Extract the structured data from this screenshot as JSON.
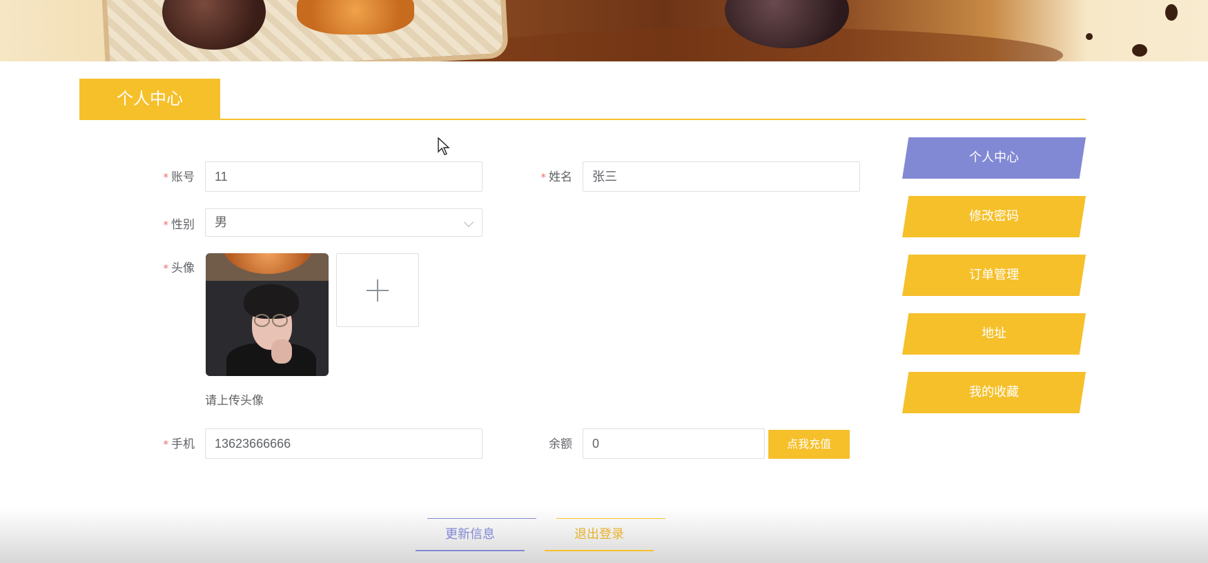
{
  "header": {
    "title": "个人中心"
  },
  "form": {
    "account": {
      "label": "账号",
      "required_mark": "*",
      "value": "11"
    },
    "name": {
      "label": "姓名",
      "required_mark": "*",
      "value": "张三"
    },
    "gender": {
      "label": "性别",
      "required_mark": "*",
      "value": "男"
    },
    "avatar": {
      "label": "头像",
      "required_mark": "*",
      "hint": "请上传头像"
    },
    "phone": {
      "label": "手机",
      "required_mark": "*",
      "value": "13623666666"
    },
    "balance": {
      "label": "余额",
      "value": "0",
      "recharge_label": "点我充值"
    }
  },
  "side_menu": {
    "items": [
      {
        "label": "个人中心",
        "active": true
      },
      {
        "label": "修改密码",
        "active": false
      },
      {
        "label": "订单管理",
        "active": false
      },
      {
        "label": "地址",
        "active": false
      },
      {
        "label": "我的收藏",
        "active": false
      }
    ]
  },
  "actions": {
    "update_label": "更新信息",
    "logout_label": "退出登录"
  },
  "colors": {
    "accent_yellow": "#f6c02b",
    "accent_purple": "#8289d4",
    "required_red": "#f56c6c"
  },
  "icons": {
    "gender_dropdown": "chevron-down-icon",
    "upload": "plus-icon",
    "cursor": "mouse-pointer-icon"
  }
}
